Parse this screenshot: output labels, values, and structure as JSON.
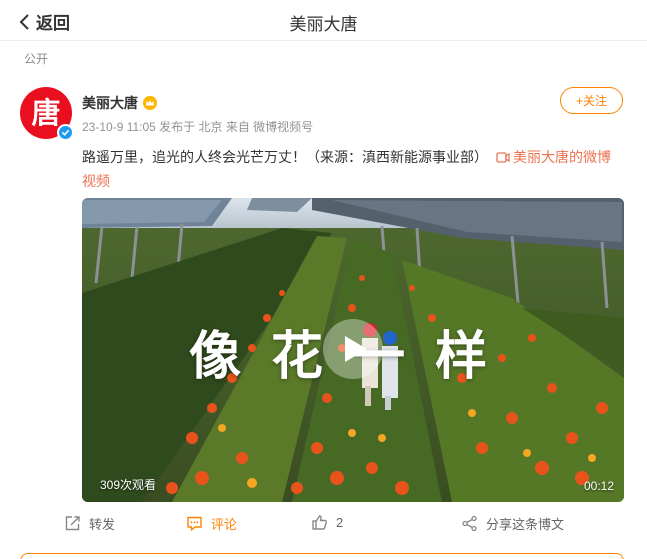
{
  "topbar": {
    "back_label": "返回",
    "title": "美丽大唐"
  },
  "visibility": "公开",
  "user": {
    "avatar_glyph": "唐",
    "name": "美丽大唐",
    "follow_label": "+关注"
  },
  "meta": {
    "text": "23-10-9 11:05  发布于 北京  来自 微博视频号"
  },
  "post": {
    "text": "路遥万里，追光的人终会光芒万丈！（来源：滇西新能源事业部）",
    "link_text": "美丽大唐的微博视频"
  },
  "video": {
    "overlay_title": "像花一样",
    "views": "309次观看",
    "duration": "00:12"
  },
  "actions": {
    "repost": "转发",
    "comment": "评论",
    "like_count": "2",
    "share": "分享这条博文"
  },
  "colors": {
    "accent": "#ff8200",
    "link": "#eb7350",
    "avatar": "#ea0f1e",
    "verified": "#1d9bf0"
  }
}
